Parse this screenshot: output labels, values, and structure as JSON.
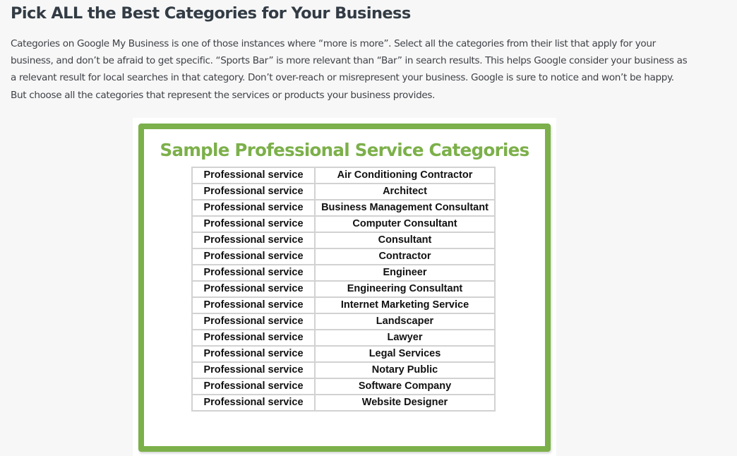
{
  "article": {
    "heading": "Pick ALL the Best Categories for Your Business",
    "paragraph": "Categories on Google My Business is one of those instances where “more is more”. Select all the categories from their list that apply for your business, and don’t be afraid to get specific. “Sports Bar” is more relevant than “Bar” in search results. This helps Google consider your business as a relevant result for local searches in that category. Don’t over-reach or misrepresent your business. Google is sure to notice and won’t be happy. But choose all the categories that represent the services or products your business provides."
  },
  "figure": {
    "title": "Sample Professional Service Categories",
    "accent_color": "#7cb04a",
    "rows": [
      {
        "type": "Professional service",
        "category": "Air Conditioning Contractor"
      },
      {
        "type": "Professional service",
        "category": "Architect"
      },
      {
        "type": "Professional service",
        "category": "Business Management Consultant"
      },
      {
        "type": "Professional service",
        "category": "Computer Consultant"
      },
      {
        "type": "Professional service",
        "category": "Consultant"
      },
      {
        "type": "Professional service",
        "category": "Contractor"
      },
      {
        "type": "Professional service",
        "category": "Engineer"
      },
      {
        "type": "Professional service",
        "category": "Engineering Consultant"
      },
      {
        "type": "Professional service",
        "category": "Internet Marketing Service"
      },
      {
        "type": "Professional service",
        "category": "Landscaper"
      },
      {
        "type": "Professional service",
        "category": "Lawyer"
      },
      {
        "type": "Professional service",
        "category": "Legal Services"
      },
      {
        "type": "Professional service",
        "category": "Notary Public"
      },
      {
        "type": "Professional service",
        "category": "Software Company"
      },
      {
        "type": "Professional service",
        "category": "Website Designer"
      }
    ]
  }
}
